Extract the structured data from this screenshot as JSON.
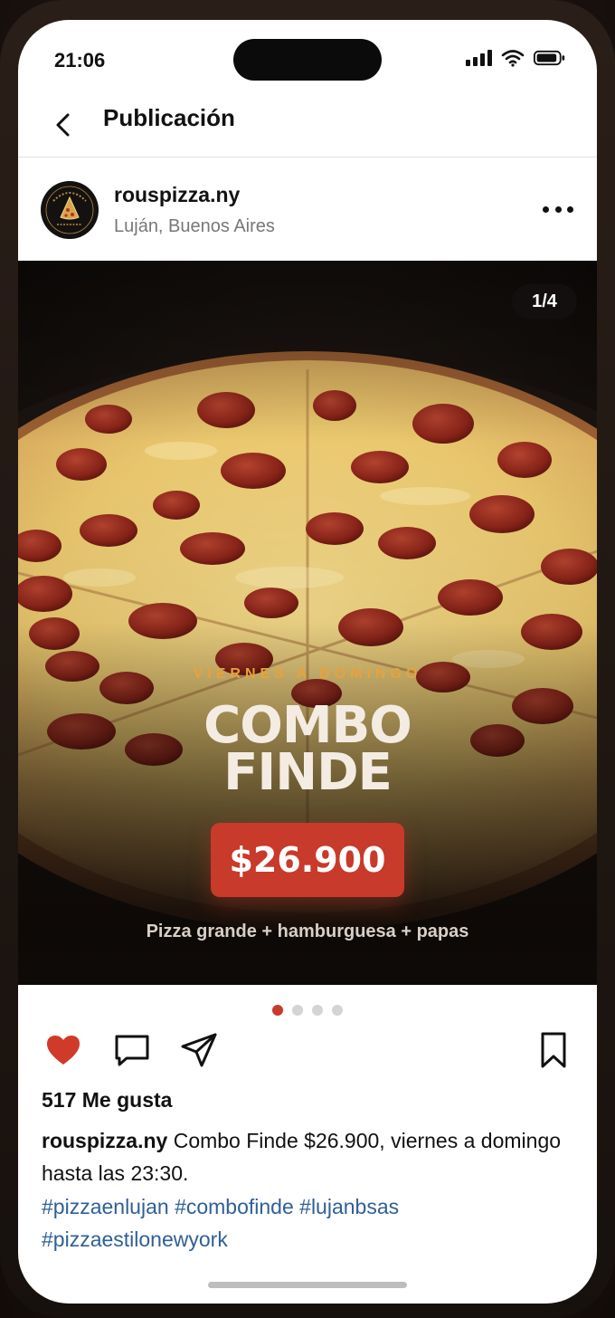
{
  "status_bar": {
    "time": "21:06"
  },
  "header": {
    "title": "Publicación"
  },
  "post": {
    "username": "rouspizza.ny",
    "location": "Luján, Buenos Aires",
    "avatar": {
      "arc_text": "ROUS PIZZA",
      "bottom_text": "NEW YORK STYLE"
    }
  },
  "media": {
    "page_counter": "1/4",
    "kicker": "VIERNES A DOMINGO",
    "title_line1": "COMBO",
    "title_line2": "FINDE",
    "price": "$26.900",
    "subtitle": "Pizza grande + hamburguesa + papas"
  },
  "carousel": {
    "total": 4,
    "active": 1
  },
  "engagement": {
    "likes": "517 Me gusta",
    "caption_user": "rouspizza.ny",
    "caption_text": " Combo Finde $26.900, viernes a domingo hasta las 23:30.",
    "hashtags": [
      "#pizzaenlujan",
      "#combofinde",
      "#lujanbsas",
      "#pizzaestilonewyork"
    ]
  },
  "colors": {
    "accent": "#c83a2a",
    "kicker": "#e8a23c",
    "hashtag": "#2f6096"
  },
  "icons": {
    "back": "chevron-left-icon",
    "more": "more-horizontal-icon",
    "like": "heart-icon",
    "comment": "comment-icon",
    "share": "send-icon",
    "save": "bookmark-icon"
  }
}
